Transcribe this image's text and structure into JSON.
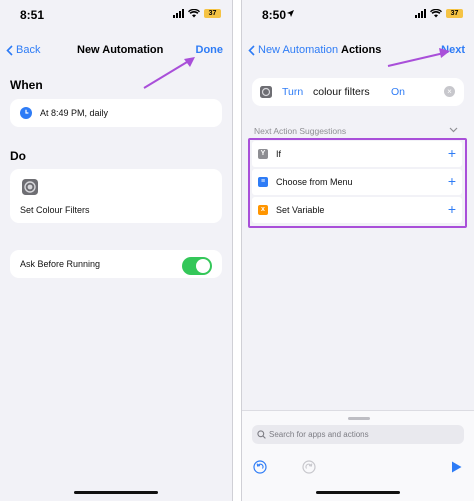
{
  "left": {
    "status": {
      "time": "8:51",
      "battery": "37"
    },
    "nav": {
      "back_label": "Back",
      "title": "New Automation",
      "done_label": "Done"
    },
    "when": {
      "heading": "When",
      "trigger_text": "At 8:49 PM, daily"
    },
    "do": {
      "heading": "Do",
      "action_text": "Set Colour Filters"
    },
    "ask": {
      "label": "Ask Before Running",
      "enabled": true
    }
  },
  "right": {
    "status": {
      "time": "8:50",
      "battery": "37"
    },
    "nav": {
      "back_label": "New Automation",
      "title": "Actions",
      "next_label": "Next"
    },
    "action": {
      "verb": "Turn",
      "object": "colour filters",
      "state": "On"
    },
    "suggestions": {
      "heading": "Next Action Suggestions",
      "items": [
        {
          "label": "If",
          "icon": "if-icon",
          "color": "#8e8e93"
        },
        {
          "label": "Choose from Menu",
          "icon": "menu-icon",
          "color": "#2e7cf6"
        },
        {
          "label": "Set Variable",
          "icon": "variable-icon",
          "color": "#ff9500"
        }
      ]
    },
    "search": {
      "placeholder": "Search for apps and actions"
    }
  },
  "colors": {
    "accent": "#2e7cf6",
    "toggle_on": "#34c759",
    "highlight": "#a94fd9"
  }
}
